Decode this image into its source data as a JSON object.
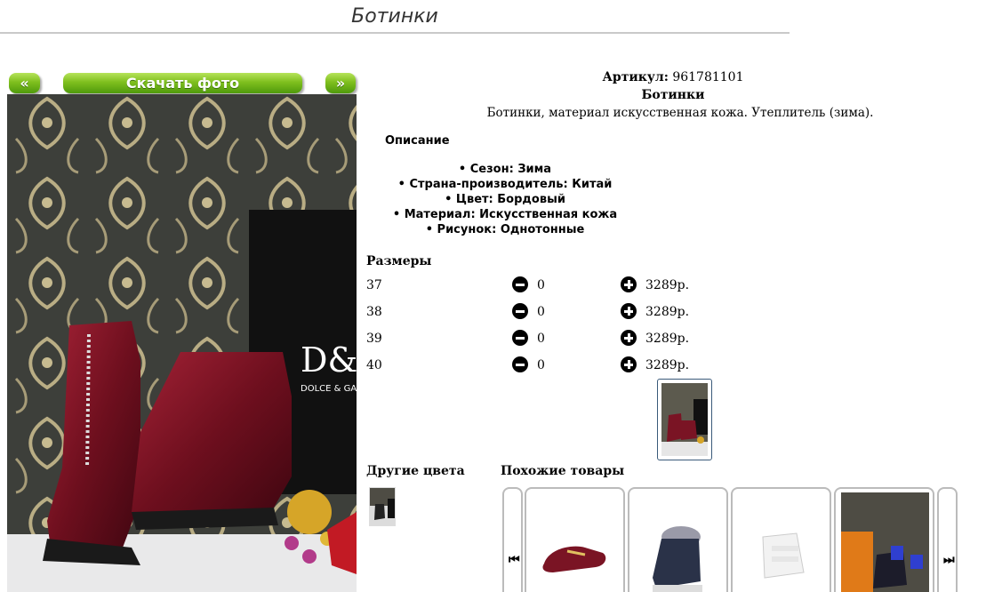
{
  "page": {
    "title": "Ботинки"
  },
  "nav": {
    "prev_label": "«",
    "download_label": "Скачать фото",
    "next_label": "»"
  },
  "product": {
    "article_label": "Артикул:",
    "article_value": "961781101",
    "name": "Ботинки",
    "short_description": "Ботинки, материал искусственная кожа. Утеплитель (зима)."
  },
  "description": {
    "heading": "Описание",
    "features": [
      "Сезон: Зима",
      "Страна-производитель: Китай",
      "Цвет: Бордовый",
      "Материал: Искусственная кожа",
      "Рисунок: Однотонные"
    ]
  },
  "sizes": {
    "heading": "Размеры",
    "rows": [
      {
        "size": "37",
        "qty": "0",
        "price": "3289р."
      },
      {
        "size": "38",
        "qty": "0",
        "price": "3289р."
      },
      {
        "size": "39",
        "qty": "0",
        "price": "3289р."
      },
      {
        "size": "40",
        "qty": "0",
        "price": "3289р."
      }
    ]
  },
  "other_colors": {
    "heading": "Другие цвета"
  },
  "similar": {
    "heading": "Похожие товары",
    "prev_glyph": "⏮",
    "next_glyph": "⏭"
  },
  "colors": {
    "accent_green": "#6aae16",
    "burgundy": "#7a1424"
  }
}
